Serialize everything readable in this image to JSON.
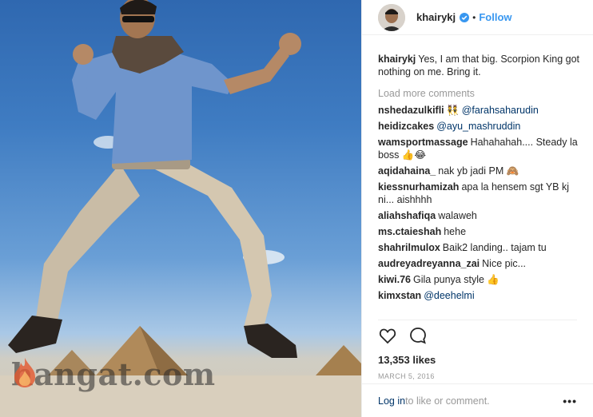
{
  "header": {
    "username": "khairykj",
    "separator": "•",
    "follow_label": "Follow"
  },
  "caption": {
    "user": "khairykj",
    "text": "Yes, I am that big. Scorpion King got nothing on me. Bring it."
  },
  "load_more_label": "Load more comments",
  "comments": [
    {
      "user": "nshedazulkifli",
      "emoji_before": "👯",
      "mention": "@farahsaharudin",
      "text": ""
    },
    {
      "user": "heidizcakes",
      "mention": "@ayu_mashruddin",
      "text": ""
    },
    {
      "user": "wamsportmassage",
      "text": "Hahahahah.... Steady la boss",
      "emoji_after": "👍😂"
    },
    {
      "user": "aqidahaina_",
      "text": "nak yb jadi PM",
      "emoji_after": "🙈"
    },
    {
      "user": "kiessnurhamizah",
      "text": "apa la hensem sgt YB kj ni... aishhhh"
    },
    {
      "user": "aliahshafiqa",
      "text": "walaweh"
    },
    {
      "user": "ms.ctaieshah",
      "text": "hehe"
    },
    {
      "user": "shahrilmulox",
      "text": "Baik2 landing.. tajam tu"
    },
    {
      "user": "audreyadreyanna_zai",
      "text": "Nice pic..."
    },
    {
      "user": "kiwi.76",
      "text": "Gila punya style",
      "emoji_after": "👍"
    },
    {
      "user": "kimxstan",
      "mention": "@deehelmi",
      "text": ""
    }
  ],
  "likes_label": "13,353 likes",
  "date": "MARCH 5, 2016",
  "footer": {
    "login_label": "Log in",
    "rest_text": " to like or comment.",
    "more_label": "•••"
  },
  "watermark": "hangat.com",
  "icons": {
    "like": "heart-icon",
    "comment": "comment-icon",
    "verified": "verified-badge-icon"
  },
  "colors": {
    "accent": "#3897f0",
    "link": "#003569",
    "muted": "#999999"
  }
}
